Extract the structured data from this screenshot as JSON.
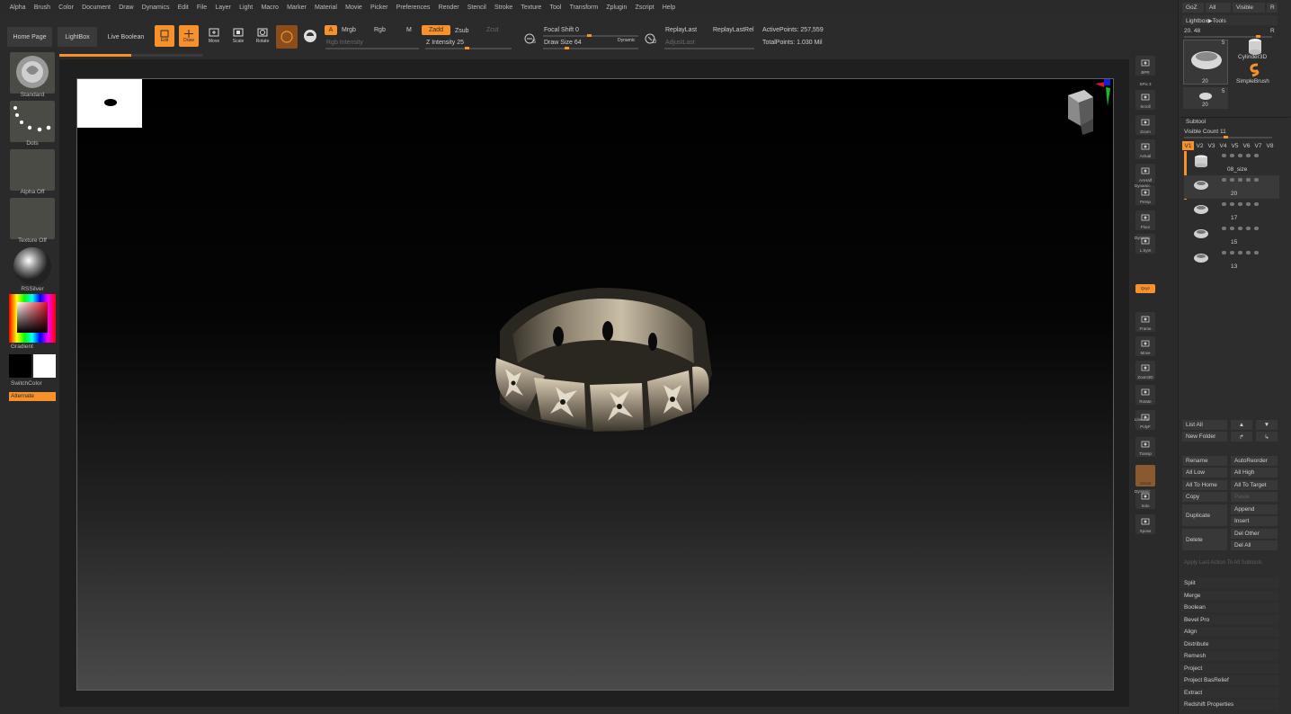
{
  "menu": [
    "Alpha",
    "Brush",
    "Color",
    "Document",
    "Draw",
    "Dynamics",
    "Edit",
    "File",
    "Layer",
    "Light",
    "Macro",
    "Marker",
    "Material",
    "Movie",
    "Picker",
    "Preferences",
    "Render",
    "Stencil",
    "Stroke",
    "Texture",
    "Tool",
    "Transform",
    "Zplugin",
    "Zscript",
    "Help"
  ],
  "topbar": {
    "home_page": "Home Page",
    "lightbox": "LightBox",
    "live_boolean": "Live Boolean",
    "edit": "Edit",
    "draw": "Draw",
    "move": "Move",
    "scale": "Scale",
    "rotate": "Rotate",
    "a": "A",
    "mrgb": "Mrgb",
    "rgb": "Rgb",
    "m": "M",
    "rgb_intensity": "Rgb Intensity",
    "zadd": "Zadd",
    "zsub": "Zsub",
    "zcut": "Zcut",
    "z_intensity": "Z Intensity 25",
    "focal_shift": "Focal Shift 0",
    "draw_size": "Draw Size 64",
    "dynamic": "Dynamic",
    "replay_last": "ReplayLast",
    "replay_last_rel": "ReplayLastRel",
    "adjust_last": "AdjustLast",
    "active_points": "ActivePoints: 257,559",
    "total_points": "TotalPoints: 1.030 Mil",
    "s_label": "S",
    "d_label": "D"
  },
  "progress": 0.5,
  "left": {
    "standard": "Standard",
    "dots": "Dots",
    "alpha_off": "Alpha Off",
    "texture_off": "Texture Off",
    "rssilver": "RSSilver",
    "gradient": "Gradient",
    "switchcolor": "SwitchColor",
    "alternate": "Alternate"
  },
  "right_shelf": [
    {
      "name": "bpr",
      "label": "BPR"
    },
    {
      "name": "spix",
      "label": "SPix 3"
    },
    {
      "name": "scroll",
      "label": "Scroll"
    },
    {
      "name": "zoom",
      "label": "Zoom"
    },
    {
      "name": "actual",
      "label": "Actual"
    },
    {
      "name": "aahalf",
      "label": "AAHalf"
    },
    {
      "name": "persp",
      "label": "Persp"
    },
    {
      "name": "floor",
      "label": "Floor"
    },
    {
      "name": "lsym",
      "label": "L.Sym"
    },
    {
      "name": "xyz",
      "label": "Qxyz"
    },
    {
      "name": "frame",
      "label": "Frame"
    },
    {
      "name": "move",
      "label": "Move"
    },
    {
      "name": "zoom3d",
      "label": "Zoom3D"
    },
    {
      "name": "rotate",
      "label": "Rotate"
    },
    {
      "name": "polyf",
      "label": "PolyF"
    },
    {
      "name": "transp",
      "label": "Transp"
    },
    {
      "name": "ghost",
      "label": "Ghost"
    },
    {
      "name": "solo",
      "label": "Solo"
    },
    {
      "name": "xpose",
      "label": "Xpose"
    }
  ],
  "right_shelf_extra": {
    "dynamic1": "Dynamic",
    "dynamic2": "Dynamic",
    "linefill": "Line Fill",
    "dynamic3": "Dynamic"
  },
  "panel": {
    "goz": "GoZ",
    "all": "All",
    "visible": "Visible",
    "r": "R",
    "lightbox_tools": "Lightbox▶Tools",
    "zoom_value": "20. 48",
    "tool_count_1": "5",
    "tool_count_2": "20",
    "tool_count_3": "5",
    "tool_count_4": "20",
    "cylinder3d": "Cylinder3D",
    "simplebrush": "SimpleBrush",
    "subtool": "Subtool",
    "visible_count": "Visible Count 11",
    "versions": [
      "V1",
      "V2",
      "V3",
      "V4",
      "V5",
      "V6",
      "V7",
      "V8"
    ],
    "subtools": [
      {
        "name": "08_size",
        "count": ""
      },
      {
        "name": "",
        "count": "20"
      },
      {
        "name": "",
        "count": "17"
      },
      {
        "name": "",
        "count": "15"
      },
      {
        "name": "",
        "count": "13"
      }
    ],
    "list_all": "List All",
    "new_folder": "New Folder",
    "rename": "Rename",
    "autoreorder": "AutoReorder",
    "all_low": "All Low",
    "all_high": "All High",
    "all_to_home": "All To Home",
    "all_to_target": "All To Target",
    "copy": "Copy",
    "paste": "Paste",
    "duplicate": "Duplicate",
    "append": "Append",
    "insert": "Insert",
    "delete": "Delete",
    "del_other": "Del Other",
    "del_all": "Del All",
    "apply_last": "Apply Last Action To All Subtools",
    "sections": [
      "Split",
      "Merge",
      "Boolean",
      "Bevel Pro",
      "Align",
      "Distribute",
      "Remesh",
      "Project",
      "Project BasRelief",
      "Extract",
      "Redshift Properties"
    ]
  },
  "colors": {
    "accent": "#f7912c",
    "bg": "#2b2b2b",
    "canvas": "#000000"
  }
}
